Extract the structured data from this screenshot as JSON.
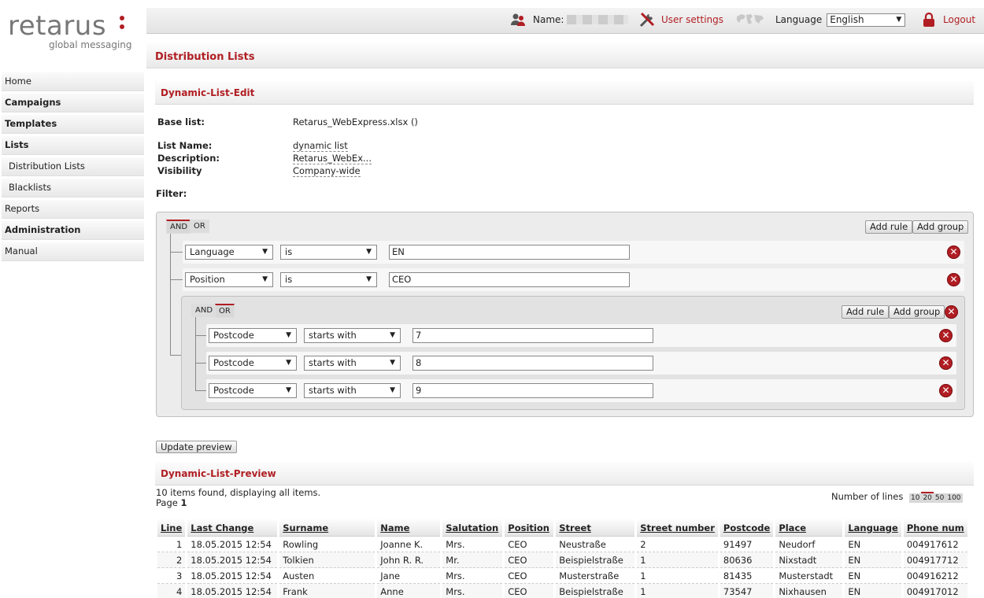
{
  "brand": {
    "name": "retarus",
    "tagline": "global messaging",
    "accent": "#b01e23"
  },
  "topbar": {
    "name_label": "Name:",
    "user_settings": "User settings",
    "language_label": "Language",
    "language_value": "English",
    "logout": "Logout"
  },
  "nav": [
    {
      "label": "Home",
      "bold": false,
      "sub": false
    },
    {
      "label": "Campaigns",
      "bold": true,
      "sub": false
    },
    {
      "label": "Templates",
      "bold": true,
      "sub": false
    },
    {
      "label": "Lists",
      "bold": true,
      "sub": false
    },
    {
      "label": "Distribution Lists",
      "bold": false,
      "sub": true
    },
    {
      "label": "Blacklists",
      "bold": false,
      "sub": true
    },
    {
      "label": "Reports",
      "bold": false,
      "sub": false
    },
    {
      "label": "Administration",
      "bold": true,
      "sub": false
    },
    {
      "label": "Manual",
      "bold": false,
      "sub": false
    }
  ],
  "page": {
    "title": "Distribution Lists"
  },
  "edit": {
    "title": "Dynamic-List-Edit",
    "base_list_label": "Base list:",
    "base_list_value": "Retarus_WebExpress.xlsx ()",
    "list_name_label": "List Name:",
    "list_name_value": "dynamic list",
    "description_label": "Description:",
    "description_value": "Retarus_WebEx...",
    "visibility_label": "Visibility",
    "visibility_value": "Company-wide",
    "filter_label": "Filter:"
  },
  "filter": {
    "and_label": "AND",
    "or_label": "OR",
    "add_rule": "Add rule",
    "add_group": "Add group",
    "rules": [
      {
        "field": "Language",
        "op": "is",
        "value": "EN"
      },
      {
        "field": "Position",
        "op": "is",
        "value": "CEO"
      }
    ],
    "group": {
      "and_label": "AND",
      "or_label": "OR",
      "active": "OR",
      "add_rule": "Add rule",
      "add_group": "Add group",
      "rules": [
        {
          "field": "Postcode",
          "op": "starts with",
          "value": "7"
        },
        {
          "field": "Postcode",
          "op": "starts with",
          "value": "8"
        },
        {
          "field": "Postcode",
          "op": "starts with",
          "value": "9"
        }
      ]
    },
    "update_preview": "Update preview"
  },
  "preview": {
    "title": "Dynamic-List-Preview",
    "summary": "10 items found, displaying all items.",
    "page_label": "Page",
    "page_number": "1",
    "lines_label": "Number of lines",
    "lines_options": [
      "10",
      "20",
      "50",
      "100"
    ],
    "lines_selected": "20",
    "columns": [
      "Line",
      "Last Change",
      "Surname",
      "Name",
      "Salutation",
      "Position",
      "Street",
      "Street number",
      "Postcode",
      "Place",
      "Language",
      "Phone num"
    ],
    "rows": [
      [
        "1",
        "18.05.2015 12:54",
        "Rowling",
        "Joanne K.",
        "Mrs.",
        "CEO",
        "Neustraße",
        "2",
        "91497",
        "Neudorf",
        "EN",
        "004917612"
      ],
      [
        "2",
        "18.05.2015 12:54",
        "Tolkien",
        "John R. R.",
        "Mr.",
        "CEO",
        "Beispielstraße",
        "1",
        "80636",
        "Nixstadt",
        "EN",
        "004917712"
      ],
      [
        "3",
        "18.05.2015 12:54",
        "Austen",
        "Jane",
        "Mrs.",
        "CEO",
        "Musterstraße",
        "1",
        "81435",
        "Musterstadt",
        "EN",
        "004916212"
      ],
      [
        "4",
        "18.05.2015 12:54",
        "Frank",
        "Anne",
        "Mrs.",
        "CEO",
        "Beispielstraße",
        "1",
        "73547",
        "Nixhausen",
        "EN",
        "004917012"
      ]
    ]
  }
}
